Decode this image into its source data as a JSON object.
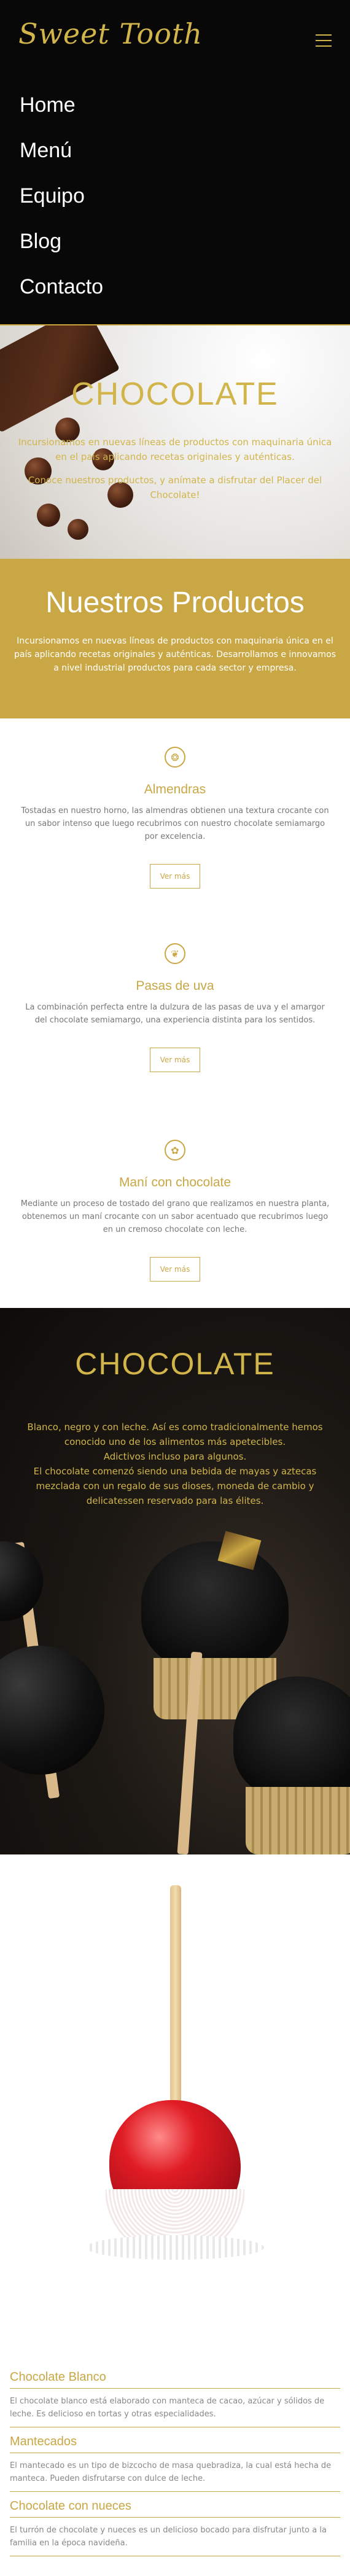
{
  "header": {
    "logo": "Sweet Tooth"
  },
  "nav": {
    "items": [
      "Home",
      "Menú",
      "Equipo",
      "Blog",
      "Contacto"
    ]
  },
  "hero": {
    "title": "CHOCOLATE",
    "p1": "Incursionamos en nuevas líneas de productos con maquinaria única en el país aplicando recetas originales y auténticas.",
    "p2": "Conoce nuestros productos, y anímate a disfrutar del Placer del Chocolate!"
  },
  "products": {
    "title": "Nuestros Productos",
    "intro": "Incursionamos en nuevas líneas de productos con maquinaria única en el país aplicando recetas originales y auténticas. Desarrollamos e innovamos a nivel industrial productos para cada sector y empresa.",
    "items": [
      {
        "name": "Almendras",
        "desc": "Tostadas en nuestro horno, las almendras obtienen una textura crocante con un sabor intenso que luego recubrimos con nuestro chocolate semiamargo por excelencia.",
        "button": "Ver más",
        "icon": "nut-icon"
      },
      {
        "name": "Pasas de uva",
        "desc": "La combinación perfecta entre la dulzura de las pasas de uva y el amargor del chocolate semiamargo, una experiencia distinta para los sentidos.",
        "button": "Ver más",
        "icon": "grape-icon"
      },
      {
        "name": "Maní con chocolate",
        "desc": "Mediante un proceso de tostado del grano que realizamos en nuestra planta, obtenemos un maní crocante con un sabor acentuado que recubrimos luego en un cremoso chocolate con leche.",
        "button": "Ver más",
        "icon": "peanut-icon"
      }
    ]
  },
  "hero2": {
    "title": "CHOCOLATE",
    "p1": "Blanco, negro y con leche. Así es como tradicionalmente hemos conocido uno de los alimentos más apetecibles.",
    "p2": "Adictivos incluso para algunos.",
    "p3": "El chocolate comenzó siendo una bebida de mayas y aztecas mezclada con un regalo de sus dioses, moneda de cambio y delicatessen reservado para las élites."
  },
  "info": [
    {
      "title": "Chocolate Blanco",
      "text": "El chocolate blanco está elaborado con manteca de cacao, azúcar y sólidos de leche. Es delicioso en tortas y otras especialidades."
    },
    {
      "title": "Mantecados",
      "text": "El mantecado es un tipo de bizcocho de masa quebradiza, la cual está hecha de manteca. Pueden disfrutarse con dulce de leche."
    },
    {
      "title": "Chocolate con nueces",
      "text": "El turrón de chocolate y nueces es un delicioso bocado para disfrutar junto a la familia en la época navideña."
    }
  ],
  "colors": {
    "gold": "#c9a744",
    "dark": "#080808"
  }
}
